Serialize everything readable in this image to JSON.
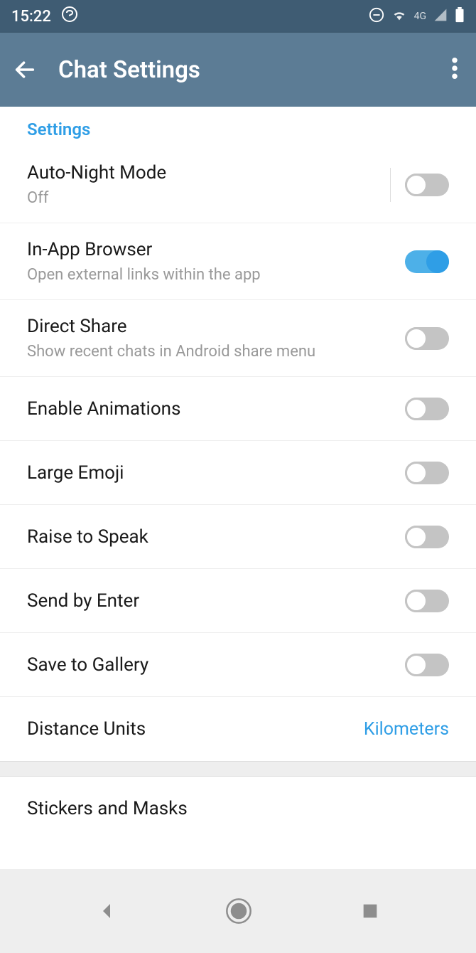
{
  "status": {
    "time": "15:22",
    "network": "4G"
  },
  "header": {
    "title": "Chat Settings"
  },
  "section": {
    "label": "Settings"
  },
  "settings": {
    "autoNight": {
      "title": "Auto-Night Mode",
      "subtitle": "Off",
      "on": false
    },
    "inAppBrowser": {
      "title": "In-App Browser",
      "subtitle": "Open external links within the app",
      "on": true
    },
    "directShare": {
      "title": "Direct Share",
      "subtitle": "Show recent chats in Android share menu",
      "on": false
    },
    "enableAnimations": {
      "title": "Enable Animations",
      "on": false
    },
    "largeEmoji": {
      "title": "Large Emoji",
      "on": false
    },
    "raiseToSpeak": {
      "title": "Raise to Speak",
      "on": false
    },
    "sendByEnter": {
      "title": "Send by Enter",
      "on": false
    },
    "saveToGallery": {
      "title": "Save to Gallery",
      "on": false
    },
    "distanceUnits": {
      "title": "Distance Units",
      "value": "Kilometers"
    },
    "stickersMasks": {
      "title": "Stickers and Masks"
    }
  }
}
